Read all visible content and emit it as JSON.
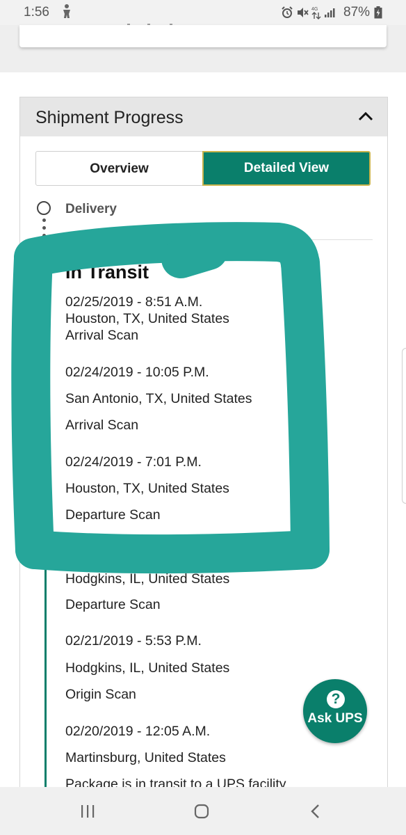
{
  "status_bar": {
    "time": "1:56",
    "network": "4G",
    "battery_pct": "87%",
    "icons": [
      "person-icon",
      "alarm-icon",
      "mute-icon",
      "data-arrows-icon",
      "signal-icon",
      "battery-icon"
    ]
  },
  "panel": {
    "title": "Shipment Progress"
  },
  "view_toggle": {
    "overview_label": "Overview",
    "detailed_label": "Detailed View",
    "selected": "Detailed View"
  },
  "timeline": {
    "delivery_label": "Delivery",
    "section_heading": "In Transit",
    "events": [
      {
        "datetime": "02/25/2019 - 8:51 A.M.",
        "location": "Houston, TX, United States",
        "status": "Arrival Scan"
      },
      {
        "datetime": "02/24/2019 - 10:05 P.M.",
        "location": "San Antonio, TX, United States",
        "status": "Arrival Scan"
      },
      {
        "datetime": "02/24/2019 - 7:01 P.M.",
        "location": "Houston, TX, United States",
        "status": "Departure Scan"
      },
      {
        "location": "Hodgkins, IL, United States",
        "status": "Departure Scan"
      },
      {
        "datetime": "02/21/2019 - 5:53 P.M.",
        "location": "Hodgkins, IL, United States",
        "status": "Origin Scan"
      },
      {
        "datetime": "02/20/2019 - 12:05 A.M.",
        "location": "Martinsburg, United States",
        "status": "Package is in transit to a UPS facility"
      }
    ]
  },
  "ask_ups": {
    "icon_text": "?",
    "label": "Ask UPS"
  },
  "colors": {
    "ups_green": "#0a7f6b",
    "marker_teal": "#26a69a",
    "tab_border_gold": "#c9b34a"
  }
}
